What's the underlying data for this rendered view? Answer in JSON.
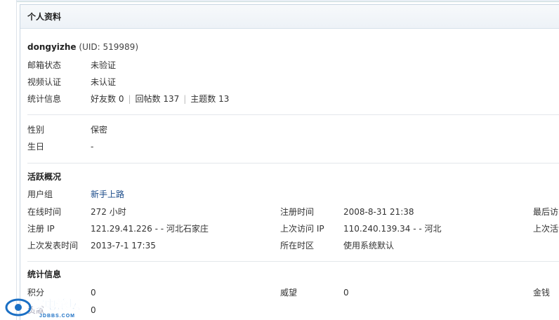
{
  "panel": {
    "title": "个人资料"
  },
  "user": {
    "name": "dongyizhe",
    "uid_text": "(UID: 519989)"
  },
  "basic": {
    "email_label": "邮箱状态",
    "email_value": "未验证",
    "video_label": "视频认证",
    "video_value": "未认证",
    "stats_label": "统计信息",
    "friends": "好友数 0",
    "replies": "回帖数 137",
    "threads": "主题数 13"
  },
  "profile": {
    "gender_label": "性别",
    "gender_value": "保密",
    "birthday_label": "生日",
    "birthday_value": "-"
  },
  "activity": {
    "title": "活跃概况",
    "group_label": "用户组",
    "group_value": "新手上路",
    "online_label": "在线时间",
    "online_value": "272 小时",
    "reg_time_label": "注册时间",
    "reg_time_value": "2008-8-31 21:38",
    "last_visit_label": "最后访问",
    "reg_ip_label": "注册 IP",
    "reg_ip_value": "121.29.41.226 - - 河北石家庄",
    "last_ip_label": "上次访问 IP",
    "last_ip_value": "110.240.139.34 - - 河北",
    "last_active_label": "上次活动",
    "last_post_label": "上次发表时间",
    "last_post_value": "2013-7-1 17:35",
    "timezone_label": "所在时区",
    "timezone_value": "使用系统默认"
  },
  "credits": {
    "title": "统计信息",
    "score_label": "积分",
    "score_value": "0",
    "prestige_label": "威望",
    "prestige_value": "0",
    "money_label": "金钱",
    "contrib_label": "贡献",
    "contrib_value": "0"
  },
  "watermark": {
    "name": "家电论坛",
    "domain": "JDBBS.COM"
  }
}
